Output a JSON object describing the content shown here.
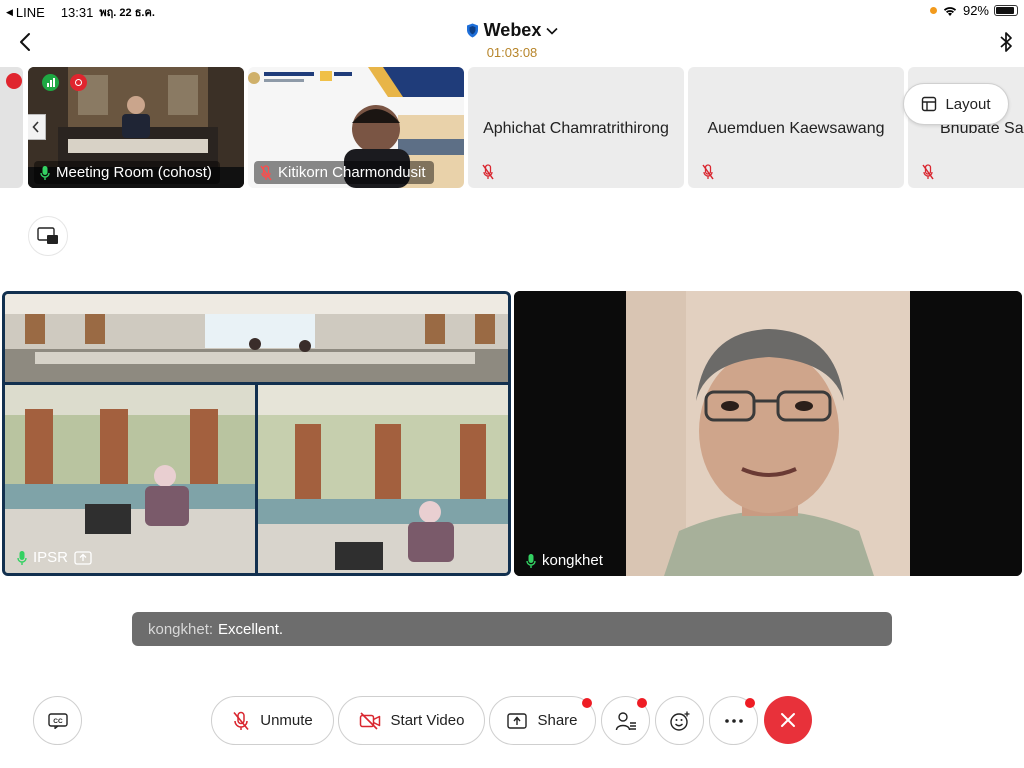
{
  "status_bar": {
    "app": "LINE",
    "time": "13:31",
    "date": "พฤ. 22 ธ.ค.",
    "battery": "92%",
    "battery_level": 0.92
  },
  "header": {
    "title": "Webex",
    "timer": "01:03:08",
    "icons": [
      "back-chevron-icon",
      "shield-icon",
      "chevron-down-icon",
      "bluetooth-icon"
    ]
  },
  "participants": [
    {
      "name": "Meeting Room (cohost)",
      "type": "video",
      "mic": "on"
    },
    {
      "name": "Kitikorn Charmondusit",
      "type": "video",
      "mic": "off"
    },
    {
      "name": "Aphichat Chamratrithirong",
      "type": "avatar",
      "mic": "off"
    },
    {
      "name": "Auemduen Kaewsawang",
      "type": "avatar",
      "mic": "off"
    },
    {
      "name": "Bhubate Sa",
      "type": "avatar",
      "mic": "off"
    }
  ],
  "layout_button": {
    "label": "Layout"
  },
  "main_videos": {
    "left": {
      "name": "IPSR"
    },
    "right": {
      "name": "kongkhet"
    }
  },
  "caption": {
    "speaker": "kongkhet:",
    "text": "Excellent."
  },
  "controls": {
    "unmute": "Unmute",
    "start_video": "Start Video",
    "share": "Share"
  },
  "colors": {
    "end_call": "#e8313a",
    "badge": "#ee1c24",
    "active_border": "#12304f",
    "timer": "#b7852a"
  }
}
